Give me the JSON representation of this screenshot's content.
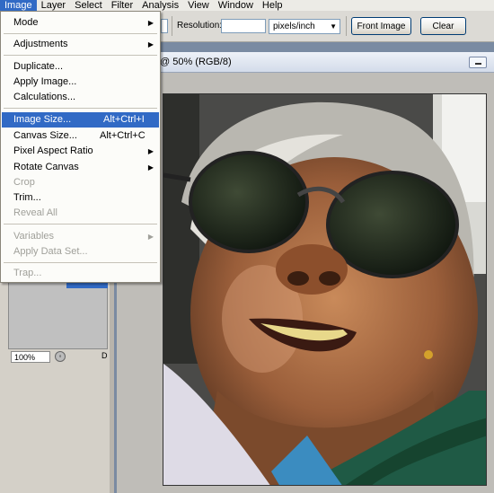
{
  "menubar": {
    "items": [
      {
        "label": "Image",
        "active": true
      },
      {
        "label": "Layer"
      },
      {
        "label": "Select"
      },
      {
        "label": "Filter"
      },
      {
        "label": "Analysis"
      },
      {
        "label": "View"
      },
      {
        "label": "Window"
      },
      {
        "label": "Help"
      }
    ]
  },
  "options": {
    "resolution_label": "Resolution:",
    "resolution_value": "",
    "units": "pixels/inch",
    "front_image": "Front Image",
    "clear": "Clear"
  },
  "document": {
    "title": "@ 50% (RGB/8)"
  },
  "navigator": {
    "zoom": "100%",
    "fragment": "D"
  },
  "image_menu": {
    "mode": "Mode",
    "adjustments": "Adjustments",
    "duplicate": "Duplicate...",
    "apply_image": "Apply Image...",
    "calculations": "Calculations...",
    "image_size": "Image Size...",
    "image_size_sc": "Alt+Ctrl+I",
    "canvas_size": "Canvas Size...",
    "canvas_size_sc": "Alt+Ctrl+C",
    "pixel_aspect": "Pixel Aspect Ratio",
    "rotate_canvas": "Rotate Canvas",
    "crop": "Crop",
    "trim": "Trim...",
    "reveal_all": "Reveal All",
    "variables": "Variables",
    "apply_data_set": "Apply Data Set...",
    "trap": "Trap..."
  },
  "colors": {
    "highlight": "#316ac5",
    "menu_bg": "#fcfcf9",
    "disabled_text": "#a0a09a"
  }
}
